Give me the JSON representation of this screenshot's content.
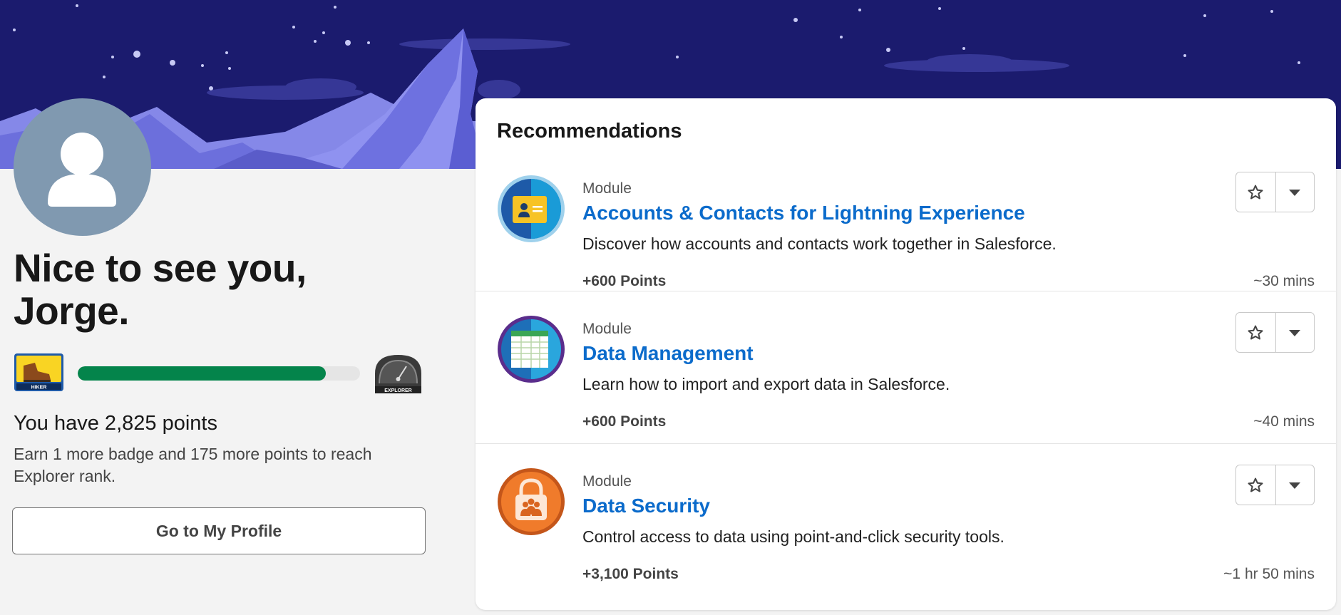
{
  "profile": {
    "greeting": "Nice to see you, Jorge.",
    "points_title": "You have 2,825 points",
    "points_subtitle": "Earn 1 more badge and 175 more points to reach Explorer rank.",
    "current_rank_badge": "HIKER",
    "next_rank_badge": "EXPLORER",
    "rank_progress_percent": 88,
    "profile_button_label": "Go to My Profile"
  },
  "recommendations": {
    "title": "Recommendations",
    "items": [
      {
        "type": "Module",
        "title": "Accounts & Contacts for Lightning Experience",
        "description": "Discover how accounts and contacts work together in Salesforce.",
        "points": "+600 Points",
        "duration": "~30 mins",
        "icon": "contact-card-icon",
        "icon_color": "#1e5aa8"
      },
      {
        "type": "Module",
        "title": "Data Management",
        "description": "Learn how to import and export data in Salesforce.",
        "points": "+600 Points",
        "duration": "~40 mins",
        "icon": "spreadsheet-icon",
        "icon_color": "#5a2d8c"
      },
      {
        "type": "Module",
        "title": "Data Security",
        "description": "Control access to data using point-and-click security tools.",
        "points": "+3,100 Points",
        "duration": "~1 hr 50 mins",
        "icon": "padlock-icon",
        "icon_color": "#f07b2b"
      }
    ]
  },
  "colors": {
    "banner": "#1b1b6e",
    "link": "#0b6bcb",
    "progress": "#04844b"
  }
}
